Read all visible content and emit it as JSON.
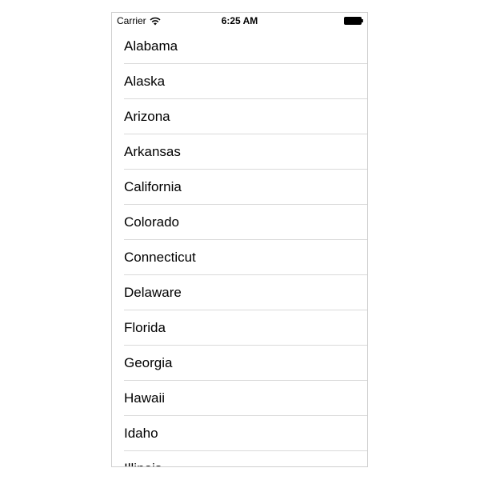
{
  "status_bar": {
    "carrier": "Carrier",
    "time": "6:25 AM",
    "wifi_icon": "wifi-icon",
    "battery_icon": "battery-icon"
  },
  "list": {
    "items": [
      "Alabama",
      "Alaska",
      "Arizona",
      "Arkansas",
      "California",
      "Colorado",
      "Connecticut",
      "Delaware",
      "Florida",
      "Georgia",
      "Hawaii",
      "Idaho",
      "Illinois"
    ]
  },
  "colors": {
    "separator": "#dadada",
    "frame_border": "#cfcfcf",
    "text": "#000000",
    "background": "#ffffff"
  }
}
